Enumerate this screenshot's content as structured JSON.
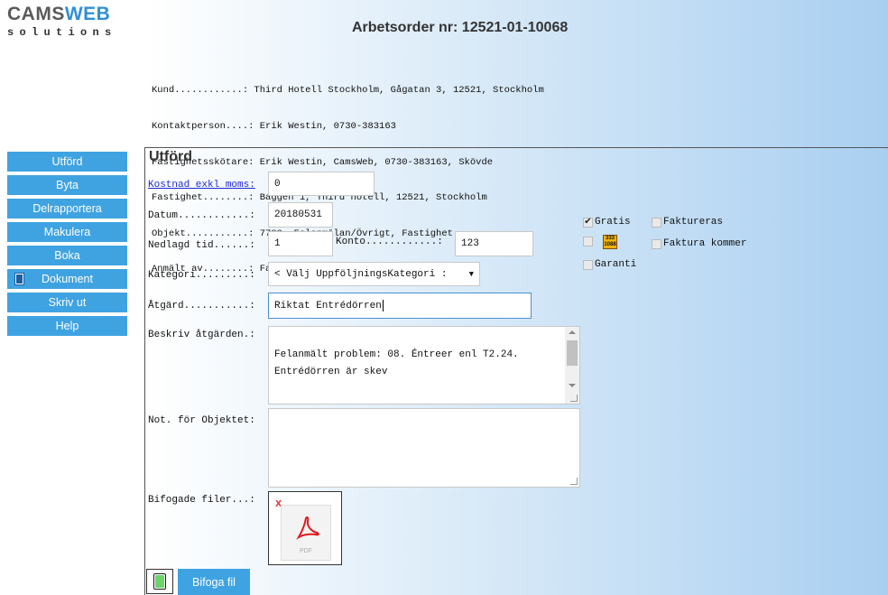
{
  "logo": {
    "part1": "CAMS",
    "part2": "WEB",
    "sub": "solutions"
  },
  "title": "Arbetsorder nr: 12521-01-10068",
  "info": [
    "Kund............: Third Hotell Stockholm, Gågatan 3, 12521, Stockholm",
    "Kontaktperson....: Erik Westin, 0730-383163",
    "Fastighetsskötare: Erik Westin, CamsWeb, 0730-383163, Skövde",
    "Fastighet........: Baggen 1, Third hotell, 12521, Stockholm",
    "Objekt...........: 7788, Felanmälan/Övrigt, Fastighet",
    "Anmält av........: Fastighetsrondering"
  ],
  "sidebar": {
    "items": [
      {
        "label": "Utförd"
      },
      {
        "label": "Byta"
      },
      {
        "label": "Delrapportera"
      },
      {
        "label": "Makulera"
      },
      {
        "label": "Boka"
      },
      {
        "label": "Dokument",
        "icon": "document-icon"
      },
      {
        "label": "Skriv ut"
      },
      {
        "label": "Help"
      }
    ]
  },
  "form": {
    "section_title": "Utförd",
    "cost_label": "Kostnad exkl moms:",
    "cost_value": "0",
    "date_label": "Datum............:",
    "date_value": "20180531",
    "time_label": "Nedlagd tid......:",
    "time_value": "1",
    "account_label": "Konto............:",
    "account_value": "123",
    "category_label": "Kategori.........:",
    "category_value": "< Välj UppföljningsKategori :",
    "category_arrow": "▼",
    "action_label": "Åtgärd...........:",
    "action_value": "Riktat Entrédörren",
    "describe_label": "Beskriv åtgärden.:",
    "describe_value": "Felanmält problem: 08. Éntreer enl T2.24.\nEntrédörren är skev",
    "note_label": "Not. för Objektet:",
    "note_value": "",
    "files_label": "Bifogade filer...:",
    "file_remove": "x",
    "file_type": "PDF",
    "attach_button": "Bifoga fil"
  },
  "options": {
    "gratis": {
      "label": "Gratis",
      "checked": true
    },
    "faktureras": {
      "label": "Faktureras",
      "checked": false
    },
    "badge_text": "333 1088",
    "faktura_kommer": {
      "label": "Faktura kommer",
      "checked": false
    },
    "garanti": {
      "label": "Garanti",
      "checked": false
    }
  },
  "colors": {
    "accent": "#3fa3e2",
    "link": "#1a29d8",
    "logo_blue": "#2f8fd6"
  }
}
